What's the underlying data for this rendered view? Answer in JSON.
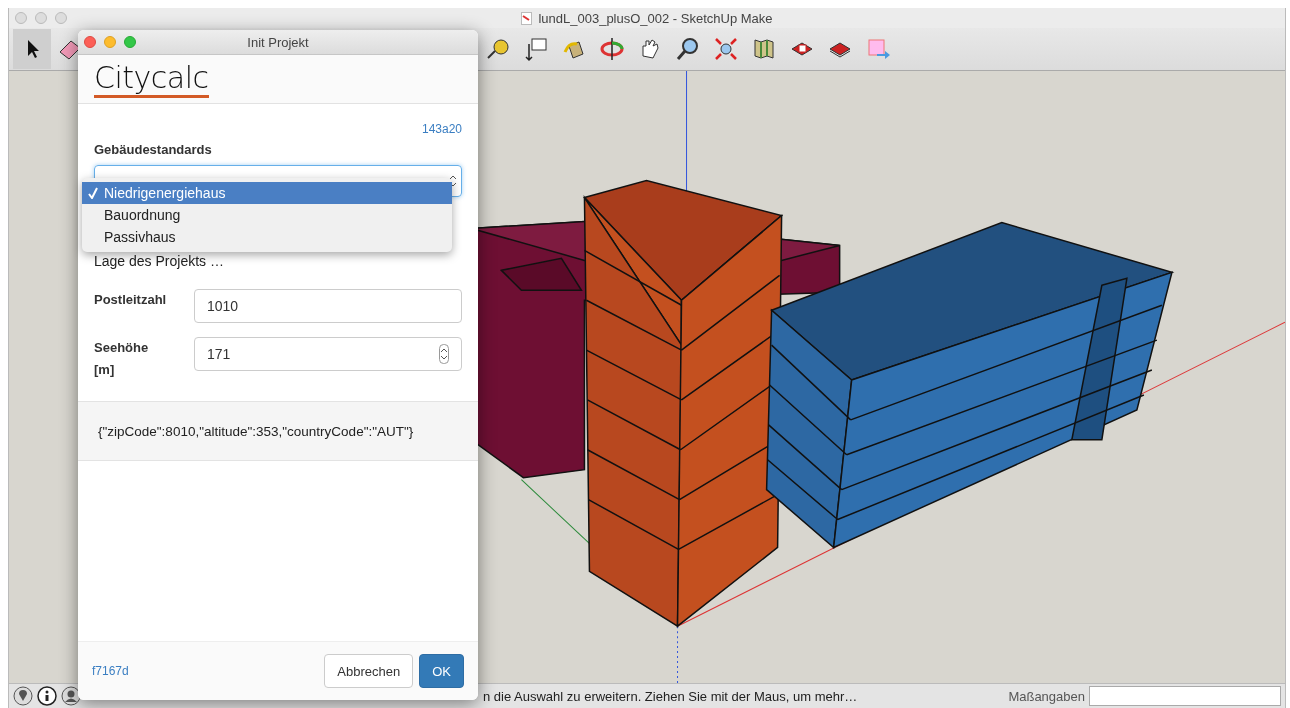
{
  "window": {
    "title": "lundL_003_plusO_002 - SketchUp Make"
  },
  "dialog": {
    "title": "Init Projekt",
    "logo": "Citycalc",
    "version": "143a20",
    "standards_label": "Gebäudestandards",
    "standards_options": [
      {
        "label": "Niedrigenergiehaus",
        "selected": true
      },
      {
        "label": "Bauordnung",
        "selected": false
      },
      {
        "label": "Passivhaus",
        "selected": false
      }
    ],
    "location_heading": "Lage des Projekts …",
    "fields": [
      {
        "label": "Postleitzahl",
        "value": "1010",
        "kind": "text"
      },
      {
        "label": "Seehöhe [m]",
        "value": "171",
        "kind": "number"
      }
    ],
    "result": "{\"zipCode\":8010,\"altitude\":353,\"countryCode\":\"AUT\"}",
    "build": "f7167d",
    "buttons": [
      {
        "label": "Abbrechen",
        "kind": "secondary"
      },
      {
        "label": "OK",
        "kind": "primary"
      }
    ]
  },
  "status_bar": {
    "hint": "n die Auswahl zu erweitern. Ziehen Sie mit der Maus, um mehr…",
    "measurements_label": "Maßangaben"
  }
}
